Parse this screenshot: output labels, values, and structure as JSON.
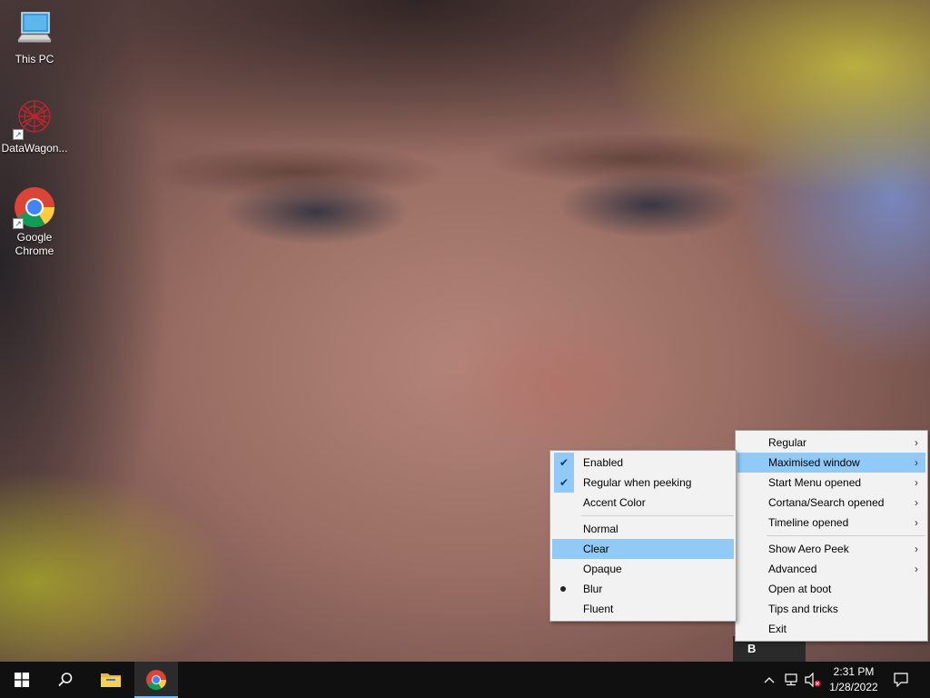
{
  "desktop": {
    "icons": [
      {
        "label": "This PC",
        "icon": "this-pc-icon"
      },
      {
        "label": "DataWagon...",
        "icon": "datawagon-icon"
      },
      {
        "label": "Google Chrome",
        "icon": "chrome-icon"
      }
    ]
  },
  "mode_menu": {
    "items": [
      {
        "label": "Enabled",
        "checked": true
      },
      {
        "label": "Regular when peeking",
        "checked": true
      },
      {
        "label": "Accent Color",
        "checked": false
      },
      {
        "label": "Normal"
      },
      {
        "label": "Clear",
        "highlighted": true
      },
      {
        "label": "Opaque"
      },
      {
        "label": "Blur",
        "selected": true
      },
      {
        "label": "Fluent"
      }
    ]
  },
  "main_menu": {
    "items": [
      {
        "label": "Regular",
        "submenu": true
      },
      {
        "label": "Maximised window",
        "submenu": true,
        "highlighted": true
      },
      {
        "label": "Start Menu opened",
        "submenu": true
      },
      {
        "label": "Cortana/Search opened",
        "submenu": true
      },
      {
        "label": "Timeline opened",
        "submenu": true
      },
      {
        "label": "Show Aero Peek",
        "submenu": true
      },
      {
        "label": "Advanced",
        "submenu": true
      },
      {
        "label": "Open at boot"
      },
      {
        "label": "Tips and tricks"
      },
      {
        "label": "Exit"
      }
    ]
  },
  "taskbar": {
    "buttons": [
      "start-icon",
      "search-icon",
      "file-explorer-icon",
      "chrome-icon"
    ],
    "tray_overflow_glyph": "^",
    "tray_app_glyph": "B",
    "clock": {
      "time": "2:31 PM",
      "date": "1/28/2022"
    }
  },
  "colors": {
    "menu_background": "#f2f2f2",
    "menu_highlight": "#91c9f7",
    "taskbar": "#101010",
    "chrome_active_indicator": "#76b9ed"
  }
}
